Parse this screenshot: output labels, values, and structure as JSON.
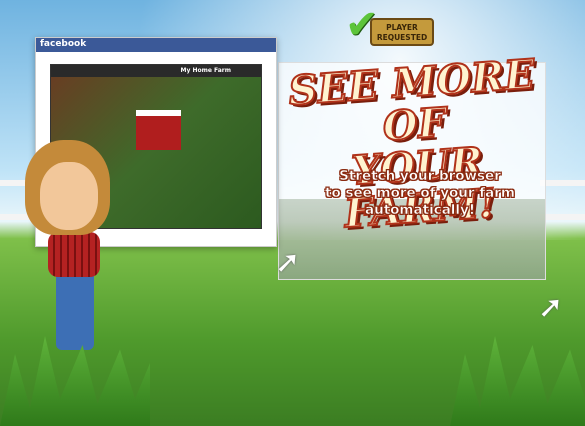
{
  "badge": {
    "label_line1": "PLAYER",
    "label_line2": "REQUESTED"
  },
  "facebook_window": {
    "brand": "facebook",
    "farm_name": "My Home Farm"
  },
  "headline": {
    "line1": "SEE MORE OF",
    "line2": "YOUR FARM!"
  },
  "subtext": {
    "line1": "Stretch your browser",
    "line2": "to see more of your farm",
    "line3": "automatically!"
  },
  "colors": {
    "headline_outline": "#b0321a",
    "facebook_blue": "#3b5998",
    "badge_gold": "#c49a3c"
  }
}
